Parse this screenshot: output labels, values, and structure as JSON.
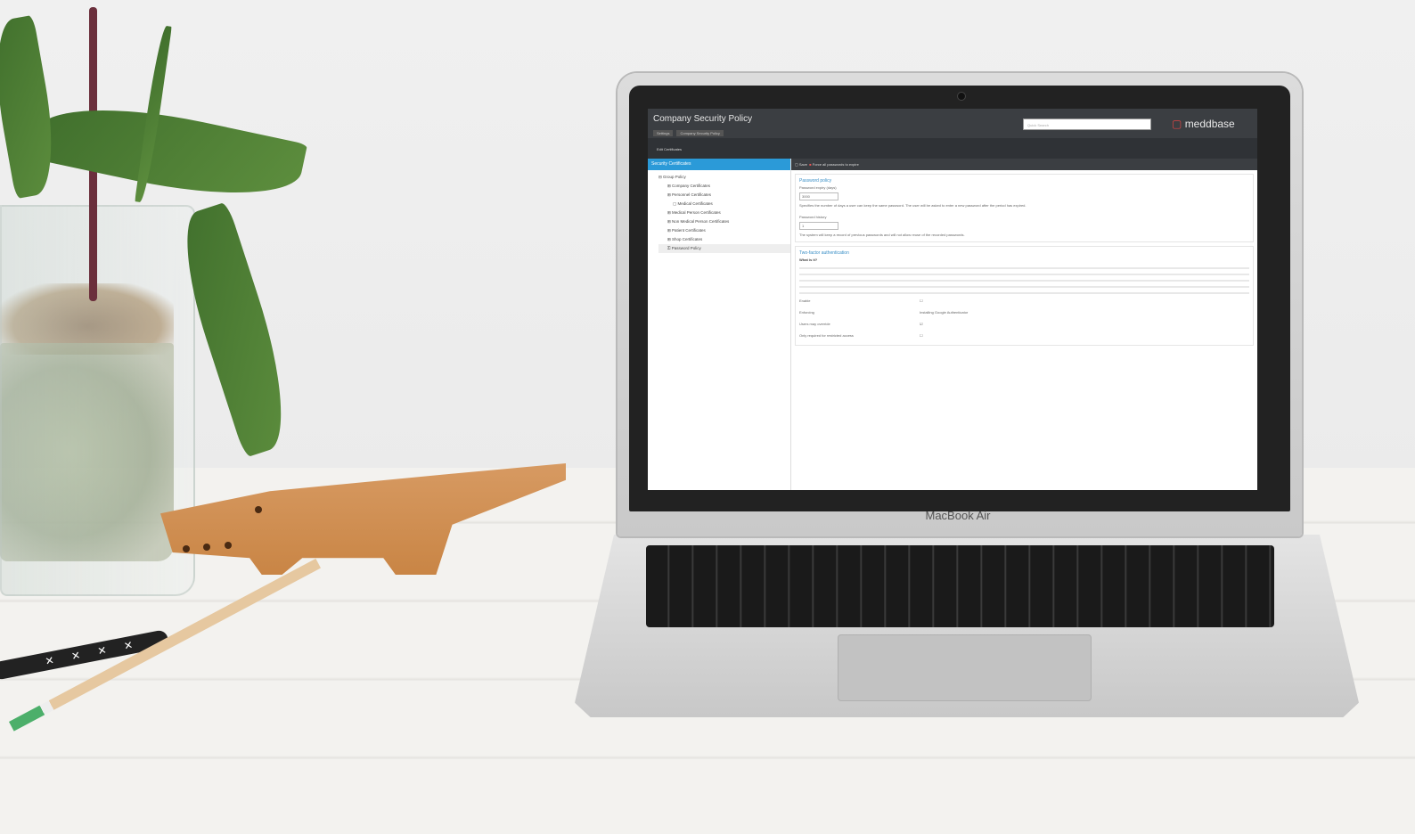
{
  "screen": {
    "title": "Company Security Policy",
    "breadcrumbs": [
      "Settings",
      "Company Security Policy"
    ],
    "search_placeholder": "Quick Search",
    "logo_text": "meddbase",
    "tab": "Edit Certificates",
    "sidebar_header": "Security Certificates",
    "tree": [
      "Group Policy",
      "Company Certificates",
      "Personnel Certificates",
      "Medical Certificates",
      "Medical Person Certificates",
      "Non Medical Person Certificates",
      "Patient Certificates",
      "Shop Certificates",
      "Password Policy"
    ],
    "toolbar_save": "Save",
    "toolbar_expire": "Force all passwords to expire",
    "password_section": {
      "heading": "Password policy",
      "expiry_label": "Password expiry (days)",
      "expiry_value": "3000",
      "expiry_help": "Specifies the number of days a user can keep the same password. The user will be asked to enter a new password after the period has expired.",
      "history_label": "Password history",
      "history_value": "1",
      "history_help": "The system will keep a record of previous passwords and will not allow reuse of the recorded passwords."
    },
    "twofactor_section": {
      "heading": "Two-factor authentication",
      "subheading": "What is it?",
      "rows": [
        {
          "label": "Enable",
          "value": "☐"
        },
        {
          "label": "Enforcing",
          "value": "Installing Google Authenticator"
        },
        {
          "label": "Users may override",
          "value": "☑"
        },
        {
          "label": "Only required for restricted access",
          "value": "☐"
        }
      ]
    }
  },
  "laptop_label": "MacBook Air"
}
